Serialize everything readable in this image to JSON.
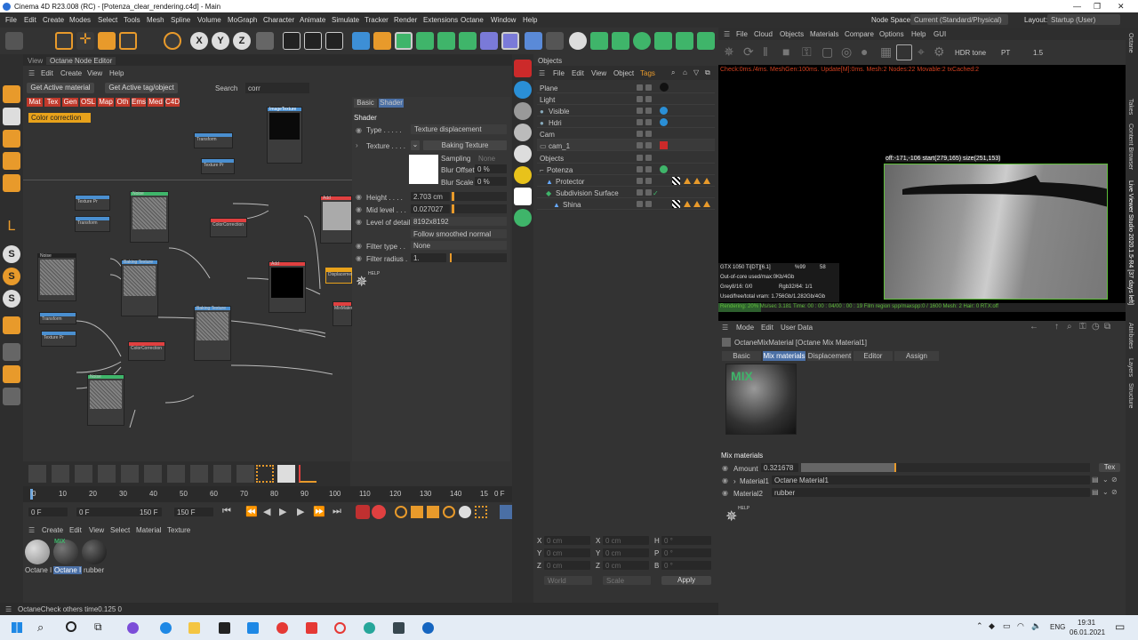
{
  "title": "Cinema 4D R23.008 (RC) - [Potenza_clear_rendering.c4d] - Main",
  "menu": [
    "File",
    "Edit",
    "Create",
    "Modes",
    "Select",
    "Tools",
    "Mesh",
    "Spline",
    "Volume",
    "MoGraph",
    "Character",
    "Animate",
    "Simulate",
    "Tracker",
    "Render",
    "Extensions",
    "Octane",
    "Window",
    "Help"
  ],
  "node_space_label": "Node Space:",
  "node_space_value": "Current (Standard/Physical)",
  "layout_label": "Layout:",
  "layout_value": "Startup (User)",
  "node_editor": {
    "tab_view": "View",
    "tab_title": "Octane Node Editor",
    "menu": [
      "Edit",
      "Create",
      "View",
      "Help"
    ],
    "btn_material": "Get Active material",
    "btn_tag": "Get Active tag/object",
    "search_label": "Search",
    "search_value": "corr",
    "categories": [
      "Mat",
      "Tex",
      "Gen",
      "OSL",
      "Map",
      "Oth",
      "Ems",
      "Med",
      "C4D"
    ],
    "search_result": "Color correction",
    "nodes": [
      "ImageTexture",
      "Transform",
      "Texture Pr",
      "Noise",
      "ColorCorrection",
      "Add",
      "Baking Texture",
      "Displacement",
      "MixMaterial"
    ]
  },
  "shader": {
    "tabs": [
      "Basic",
      "Shader"
    ],
    "header": "Shader",
    "type_label": "Type . . . . .",
    "type_value": "Texture displacement",
    "texture_label": "Texture . . . .",
    "texture_value": "Baking Texture",
    "sampling_label": "Sampling",
    "sampling_value": "None",
    "blur_offset_label": "Blur Offset",
    "blur_offset_value": "0 %",
    "blur_scale_label": "Blur Scale",
    "blur_scale_value": "0 %",
    "height_label": "Height . . . .",
    "height_value": "2.703 cm",
    "mid_label": "Mid level . . .",
    "mid_value": "0.027027",
    "lod_label": "Level of detail",
    "lod_value": "8192x8192",
    "follow_value": "Follow smoothed normal",
    "filter_type_label": "Filter type . .",
    "filter_type_value": "None",
    "filter_radius_label": "Filter radius .",
    "filter_radius_value": "1.",
    "help": "HELP"
  },
  "timeline": {
    "ticks": [
      "0",
      "10",
      "20",
      "30",
      "40",
      "50",
      "60",
      "70",
      "80",
      "90",
      "100",
      "110",
      "120",
      "130",
      "140",
      "15"
    ],
    "frame_end": "0 F",
    "start": "0 F",
    "cur": "0 F",
    "end": "150 F",
    "end2": "150 F"
  },
  "materials": {
    "menu": [
      "Create",
      "Edit",
      "View",
      "Select",
      "Material",
      "Texture"
    ],
    "items": [
      "Octane I",
      "Octane I",
      "rubber"
    ],
    "mix_label": "MIX"
  },
  "objects": {
    "tab": "Objects",
    "menu": [
      "File",
      "Edit",
      "View",
      "Object",
      "Tags"
    ],
    "rows": [
      "Plane",
      "Light",
      "Visible",
      "Hdri",
      "Cam",
      "cam_1",
      "Objects",
      "Potenza",
      "Protector",
      "Subdivision Surface",
      "Shina"
    ]
  },
  "coords": {
    "x": "X",
    "y": "Y",
    "z": "Z",
    "x2": "X",
    "y2": "Y",
    "z2": "Z",
    "h": "H",
    "p": "P",
    "b": "B",
    "vx": "0 cm",
    "vy": "0 cm",
    "vz": "0 cm",
    "vx2": "0 cm",
    "vy2": "0 cm",
    "vz2": "0 cm",
    "vh": "0 °",
    "vp": "0 °",
    "vb": "0 °",
    "world": "World",
    "scale": "Scale",
    "apply": "Apply"
  },
  "viewer": {
    "menu": [
      "File",
      "Cloud",
      "Objects",
      "Materials",
      "Compare",
      "Options",
      "Help",
      "GUI"
    ],
    "hdr": "HDR tone",
    "pt": "PT",
    "num": "1.5",
    "status": "Check:0ms./4ms. MeshGen:100ms. Update[M]:0ms. Mesh:2 Nodes:22 Movable:2 txCached:2",
    "region": "off:-171,-106 start(279,165) size(251,153)",
    "gpu": "GTX 1050 Ti[DT][6.1]",
    "gpu_pct": "%99",
    "gpu_temp": "58",
    "ooc": "Out-of-core used/max:0Kb/4Gb",
    "grey": "Grey8/16: 0/0",
    "rgb": "Rgb32/64: 1/1",
    "vram": "Used/free/total vram: 1.756Gb/1.282Gb/4Gb",
    "render": "Rendering: 20%   Ms/sec 3.181   Time: 00 : 00 : 04/00 : 00 : 19   Film region spp/maxspp:0 / 1600   Mesh: 2  Hair: 0    RTX:off"
  },
  "attributes": {
    "menu": [
      "Mode",
      "Edit",
      "User Data"
    ],
    "title": "OctaneMixMaterial [Octane Mix Material1]",
    "tabs": [
      "Basic",
      "Mix materials",
      "Displacement",
      "Editor",
      "Assign"
    ],
    "section": "Mix materials",
    "amount_label": "Amount",
    "amount_value": "0.321678",
    "amount_fill": 0.321678,
    "tex_btn": "Tex",
    "material1_label": "Material1",
    "material1_value": "Octane Material1",
    "material2_label": "Material2",
    "material2_value": "rubber",
    "help": "HELP",
    "mix_label": "MIX"
  },
  "side_tabs": [
    "Octane",
    "Takes",
    "Content Browser",
    "Live Viewer Studio 2020.1.5-R4 [37 days left]",
    "Attributes",
    "Layers",
    "Structure"
  ],
  "statusbar": "OctaneCheck others time0.125  0",
  "taskbar": {
    "lang": "ENG",
    "time": "19:31",
    "date": "06.01.2021"
  },
  "colors": {
    "accent_orange": "#e89a2b",
    "highlight_blue": "#4a6fa5",
    "viewer_bg": "#000000",
    "render_green": "#5fbf3a",
    "status_red": "#d04020"
  }
}
